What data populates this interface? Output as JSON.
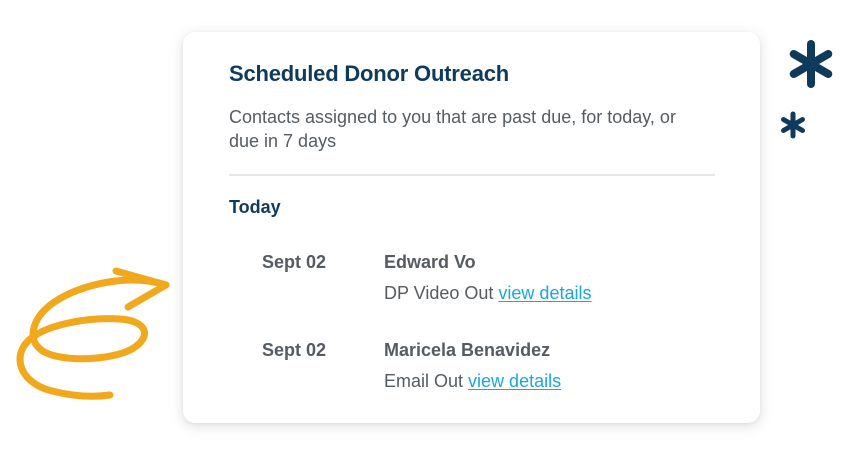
{
  "card": {
    "title": "Scheduled Donor Outreach",
    "description": "Contacts assigned to you that are past due, for today, or due in 7  days",
    "section_heading": "Today",
    "rows": [
      {
        "date": "Sept 02",
        "name": "Edward Vo",
        "activity": "DP Video Out",
        "link_label": "view details"
      },
      {
        "date": "Sept 02",
        "name": "Maricela Benavidez",
        "activity": "Email Out",
        "link_label": "view details"
      }
    ]
  },
  "decorations": {
    "arrow_color": "#f2a81d",
    "asterisk_color": "#0f3a5c",
    "icons": [
      "asterisk-icon",
      "asterisk-icon",
      "squiggle-arrow-icon"
    ]
  },
  "colors": {
    "heading": "#0f3a5c",
    "body_text": "#555b61",
    "link": "#1aa7e0",
    "divider": "#e6e7e8"
  }
}
